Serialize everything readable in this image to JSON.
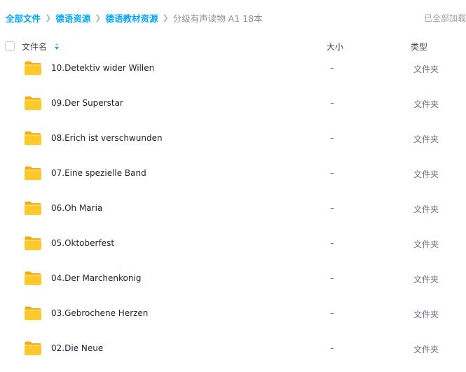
{
  "breadcrumb": {
    "items": [
      "全部文件",
      "德语资源",
      "德语教材资源"
    ],
    "current": "分级有声读物 A1 18本"
  },
  "status": "已全部加载",
  "header": {
    "name": "文件名",
    "size": "大小",
    "type": "类型"
  },
  "icons": {
    "breadcrumb_separator": "chevron-right-icon",
    "sort": "sort-icon",
    "folder": "folder-icon"
  },
  "colors": {
    "link": "#06a7ff",
    "folder": "#ffc82b"
  },
  "files": [
    {
      "name": "10.Detektiv wider Willen",
      "size": "–",
      "type": "文件夹"
    },
    {
      "name": "09.Der Superstar",
      "size": "–",
      "type": "文件夹"
    },
    {
      "name": "08.Erich ist verschwunden",
      "size": "–",
      "type": "文件夹"
    },
    {
      "name": "07.Eine spezielle Band",
      "size": "–",
      "type": "文件夹"
    },
    {
      "name": "06.Oh Maria",
      "size": "–",
      "type": "文件夹"
    },
    {
      "name": "05.Oktoberfest",
      "size": "–",
      "type": "文件夹"
    },
    {
      "name": "04.Der Marchenkonig",
      "size": "–",
      "type": "文件夹"
    },
    {
      "name": "03.Gebrochene Herzen",
      "size": "–",
      "type": "文件夹"
    },
    {
      "name": "02.Die Neue",
      "size": "–",
      "type": "文件夹"
    }
  ]
}
